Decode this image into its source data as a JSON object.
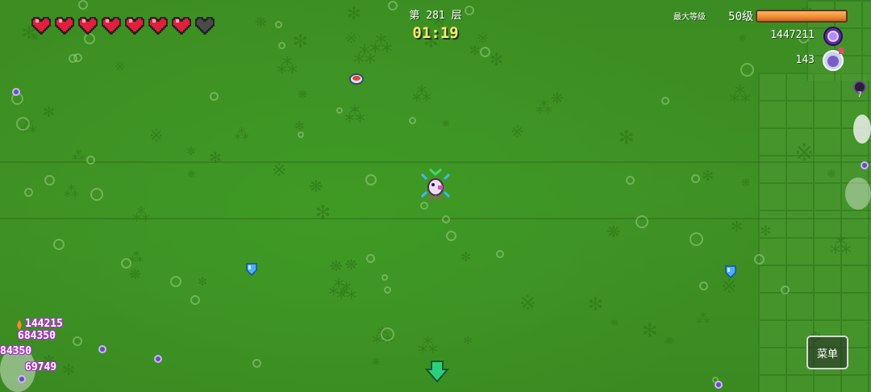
{
  "hud": {
    "hearts": {
      "total": 8,
      "filled": 7
    },
    "floor_label": "第 281 层",
    "timer": "01:19",
    "max_level_label": "最大等级",
    "level_text": "50级",
    "xp_fraction": 1.0,
    "coins": "1447211",
    "gems": "143",
    "side_counter": "7"
  },
  "damage_numbers": [
    "144215",
    "684350",
    "84350",
    "69749"
  ],
  "menu": {
    "label": "菜单"
  },
  "icons": {
    "heart": "heart-icon",
    "coin": "purple-coin-icon",
    "potion": "potion-icon",
    "gem": "blue-gem-icon",
    "stairs": "down-arrow-icon",
    "flame": "flame-icon"
  },
  "colors": {
    "heart_full": "#e0203c",
    "heart_empty": "#4a4a4a",
    "timer": "#ffe870",
    "xp_bar": "#f08c32",
    "damage_outline": "#b22fd6",
    "gem": "#4ab0ff"
  }
}
